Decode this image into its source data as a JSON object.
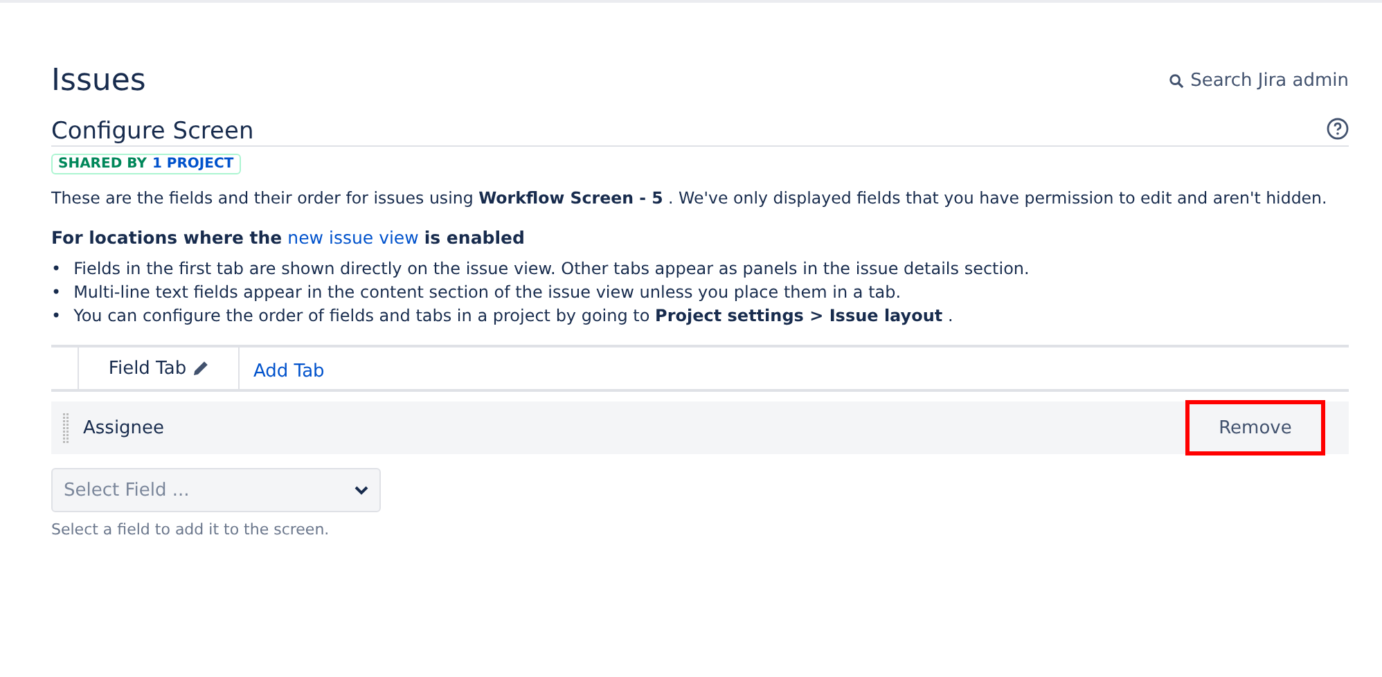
{
  "page_title": "Issues",
  "search": {
    "label": "Search Jira admin"
  },
  "section": {
    "title": "Configure Screen",
    "badge": {
      "shared": "SHARED BY",
      "link": "1 PROJECT"
    }
  },
  "description": "These are the fields and their order for issues using **Workflow Screen - 5** . We've only displayed fields that you have permission to edit and aren't hidden.",
  "locations": {
    "before": "For locations where the",
    "link": "new issue view",
    "after": "is enabled"
  },
  "bullets": [
    {
      "marker": "•",
      "text": "Fields in the first tab are shown directly on the issue view. Other tabs appear as panels in the issue details section."
    },
    {
      "marker": "•",
      "text": "Multi-line text fields appear in the content section of the issue view unless you place them in a tab."
    },
    {
      "marker": "•",
      "text": "You can configure the order of fields and tabs in a project by going to **Project settings > Issue layout** ."
    }
  ],
  "tabs": [
    {
      "label": "Field Tab",
      "selected": true,
      "kind": "tab"
    },
    {
      "label": "Add Tab",
      "selected": false,
      "kind": "link"
    }
  ],
  "fields": [
    {
      "name": "Assignee",
      "action": "Remove",
      "highlighted": true
    }
  ],
  "select": {
    "placeholder": "Select Field ...",
    "hint": "Select a field to add it to the screen."
  }
}
